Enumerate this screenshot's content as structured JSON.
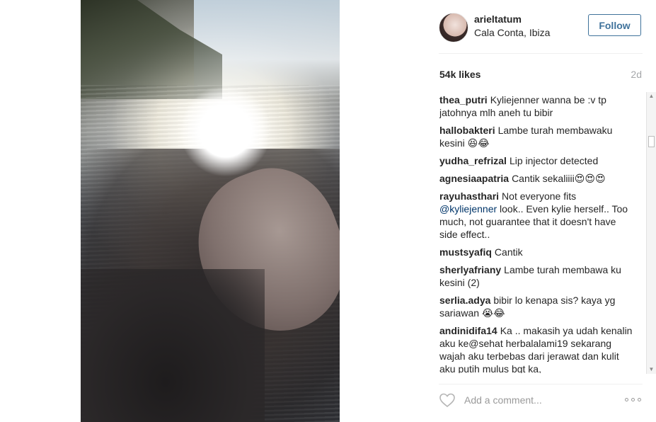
{
  "post": {
    "username": "arieltatum",
    "location": "Cala Conta, Ibiza",
    "follow_label": "Follow",
    "likes": "54k likes",
    "time_ago": "2d",
    "add_comment_placeholder": "Add a comment...",
    "accent_color": "#3f729b"
  },
  "comments": [
    {
      "user": "thea_putri",
      "text": "Kyliejenner wanna be :v tp jatohnya mlh aneh tu bibir"
    },
    {
      "user": "hallobakteri",
      "text": "Lambe turah membawaku kesini 😆😂"
    },
    {
      "user": "yudha_refrizal",
      "text": "Lip injector detected"
    },
    {
      "user": "agnesiaapatria",
      "text": "Cantik sekaliiii😍😍😍"
    },
    {
      "user": "rayuhasthari",
      "text_before": "Not everyone fits",
      "mention": "@kyliejenner",
      "text_after": " look.. Even kylie herself.. Too much, not guarantee that it doesn't have side effect.."
    },
    {
      "user": "mustsyafiq",
      "text": "Cantik"
    },
    {
      "user": "sherlyafriany",
      "text": "Lambe turah membawa ku kesini (2)"
    },
    {
      "user": "serlia.adya",
      "text": "bibir lo kenapa sis? kaya yg sariawan 😭😂"
    },
    {
      "user": "andinidifa14",
      "text": "Ka .. makasih ya udah kenalin aku ke@sehat  herbalalami19 sekarang wajah aku terbebas dari jerawat dan kulit aku putih mulus bgt ka,"
    }
  ],
  "icons": {
    "like": "heart-icon",
    "more": "more-options-icon"
  }
}
